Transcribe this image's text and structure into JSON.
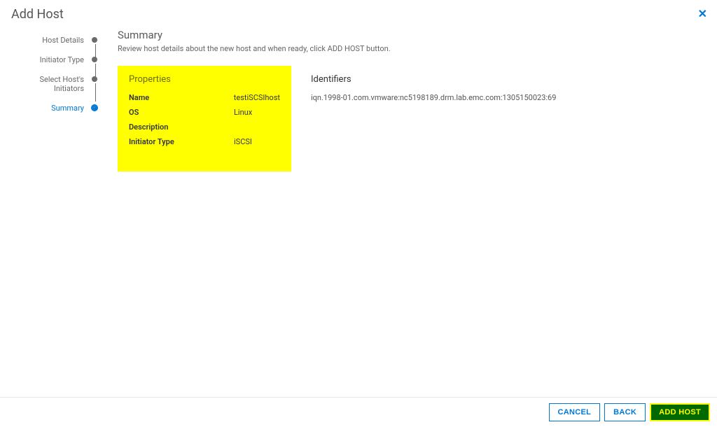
{
  "dialog": {
    "title": "Add Host"
  },
  "steps": [
    {
      "label": "Host Details"
    },
    {
      "label": "Initiator Type"
    },
    {
      "label": "Select Host's Initiators"
    },
    {
      "label": "Summary"
    }
  ],
  "summary": {
    "title": "Summary",
    "subtitle": "Review host details about the new host and when ready, click ADD HOST button."
  },
  "properties": {
    "heading": "Properties",
    "labels": {
      "name": "Name",
      "os": "OS",
      "description": "Description",
      "initiator_type": "Initiator Type"
    },
    "values": {
      "name": "testiSCSIhost",
      "os": "Linux",
      "description": "",
      "initiator_type": "iSCSI"
    }
  },
  "identifiers": {
    "heading": "Identifiers",
    "items": [
      "iqn.1998-01.com.vmware:nc5198189.drm.lab.emc.com:1305150023:69"
    ]
  },
  "buttons": {
    "cancel": "CANCEL",
    "back": "BACK",
    "submit": "ADD HOST"
  }
}
